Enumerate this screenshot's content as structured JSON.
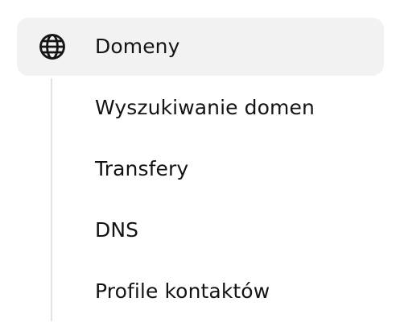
{
  "nav": {
    "parent": {
      "label": "Domeny",
      "icon": "globe-icon"
    },
    "items": [
      {
        "label": "Wyszukiwanie domen"
      },
      {
        "label": "Transfery"
      },
      {
        "label": "DNS"
      },
      {
        "label": "Profile kontaktów"
      }
    ]
  },
  "colors": {
    "active_background": "#f2f2f2",
    "tree_line": "#e3e3e3",
    "text": "#141414"
  }
}
